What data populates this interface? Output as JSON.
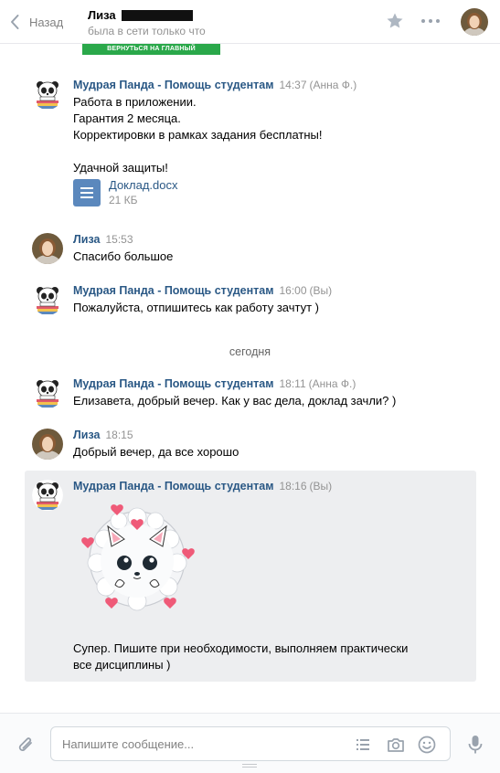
{
  "header": {
    "back_label": "Назад",
    "peer_name": "Лиза",
    "peer_status": "была в сети только что"
  },
  "banner": {
    "text": "ВЕРНУТЬСЯ НА ГЛАВНЫЙ"
  },
  "messages": [
    {
      "author": "Мудрая Панда - Помощь студентам",
      "time": "14:37",
      "by": "(Анна Ф.)",
      "lines": [
        "Работа в приложении.",
        "Гарантия 2 месяца.",
        "Корректировки в рамках задания бесплатны!",
        "",
        "Удачной защиты!"
      ],
      "attachment": {
        "name": "Доклад.docx",
        "size": "21 КБ"
      }
    },
    {
      "author": "Лиза",
      "time": "15:53",
      "lines": [
        "Спасибо большое"
      ]
    },
    {
      "author": "Мудрая Панда - Помощь студентам",
      "time": "16:00",
      "by": "(Вы)",
      "lines": [
        "Пожалуйста, отпишитесь как работу зачтут )"
      ]
    },
    {
      "author": "Мудрая Панда - Помощь студентам",
      "time": "18:11",
      "by": "(Анна Ф.)",
      "lines": [
        "Елизавета, добрый вечер. Как у вас дела, доклад зачли? )"
      ]
    },
    {
      "author": "Лиза",
      "time": "18:15",
      "lines": [
        "Добрый вечер, да все хорошо"
      ]
    },
    {
      "author": "Мудрая Панда - Помощь студентам",
      "time": "18:16",
      "by": "(Вы)",
      "lines": [
        "Супер. Пишите при необходимости, выполняем практически",
        "все дисциплины )"
      ]
    }
  ],
  "date_divider": "сегодня",
  "composer": {
    "placeholder": "Напишите сообщение..."
  },
  "colors": {
    "link": "#2a5885",
    "muted": "#939393",
    "selected_bg": "#edeef0",
    "banner": "#2aa84a",
    "doc_icon": "#5b88bd"
  }
}
